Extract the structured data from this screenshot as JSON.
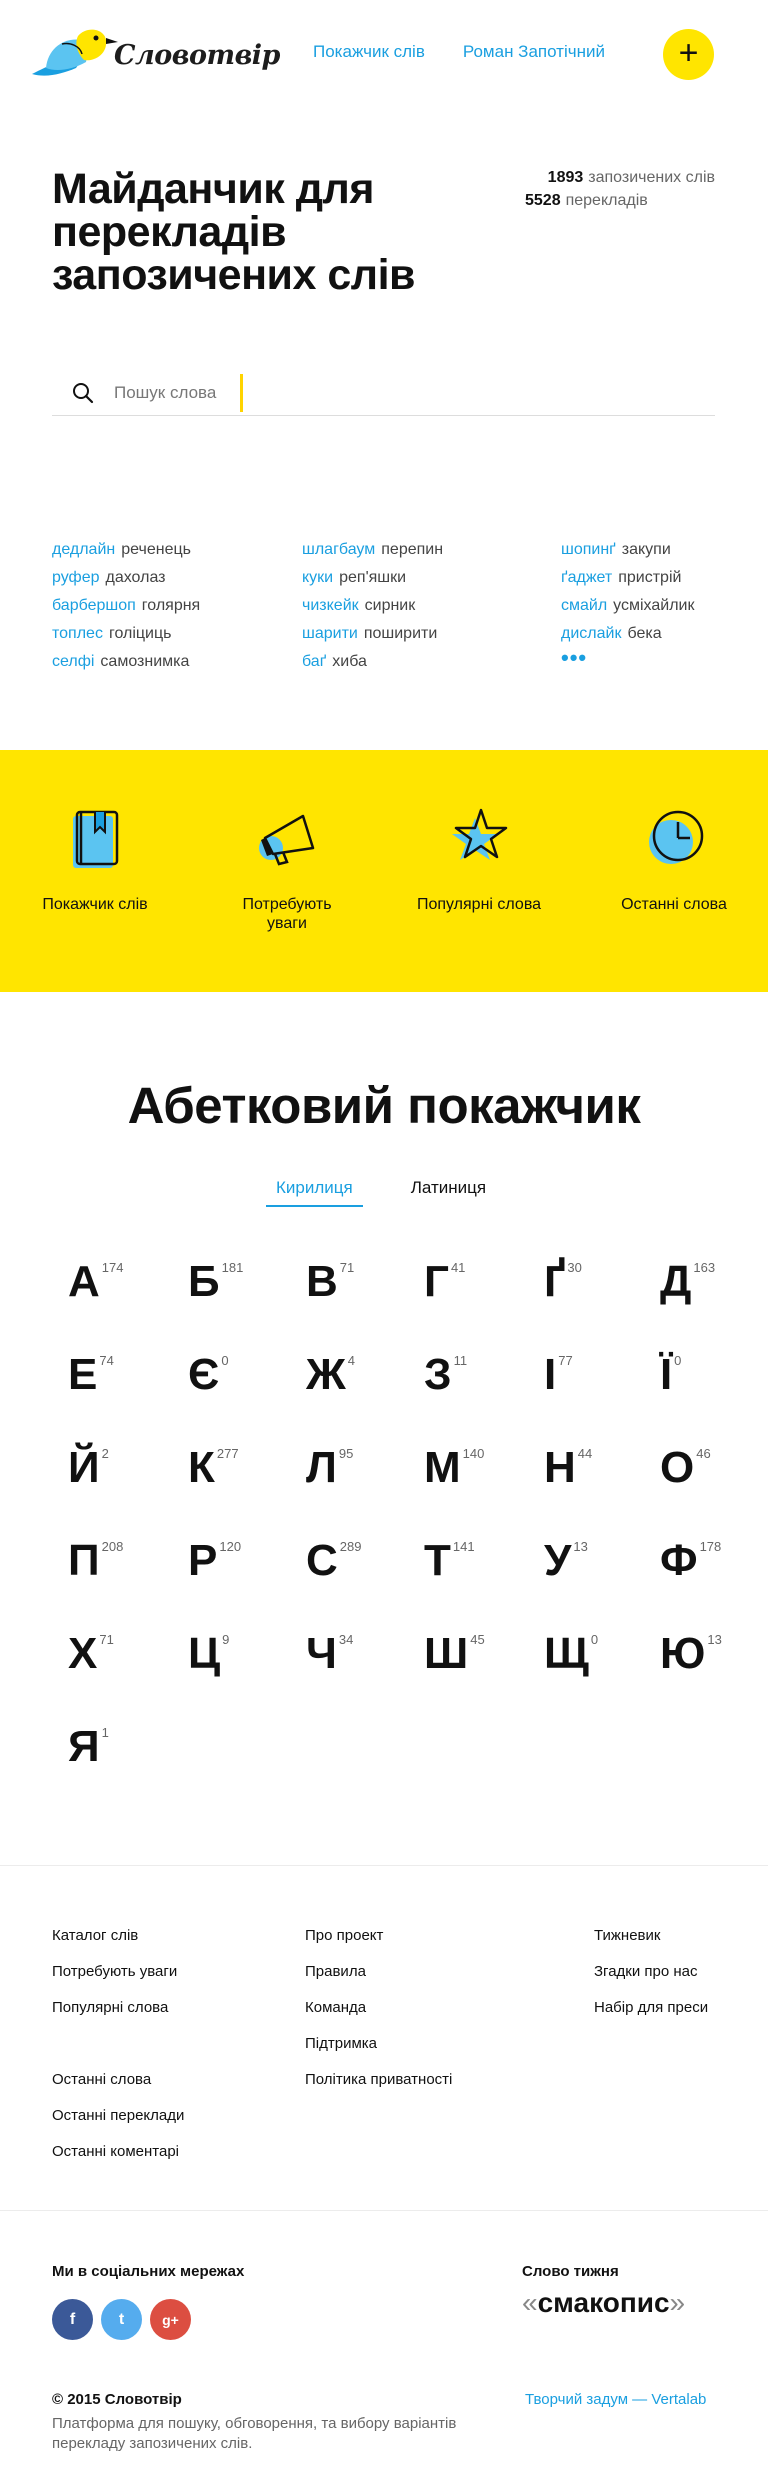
{
  "header": {
    "logo_text": "Словотвір",
    "nav": [
      "Покажчик слів",
      "Роман Запотічний"
    ],
    "add_label": "+"
  },
  "hero": {
    "title": "Майданчик для перекладів запозичених слів",
    "stats": [
      {
        "count": "1893",
        "label": "запозичених слів"
      },
      {
        "count": "5528",
        "label": "перекладів"
      }
    ],
    "search_placeholder": "Пошук слова"
  },
  "pairs": {
    "col1": [
      {
        "src": "дедлайн",
        "tr": "реченець"
      },
      {
        "src": "руфер",
        "tr": "дахолаз"
      },
      {
        "src": "барбершоп",
        "tr": "голярня"
      },
      {
        "src": "топлес",
        "tr": "голіциць"
      },
      {
        "src": "селфі",
        "tr": "самознимка"
      }
    ],
    "col2": [
      {
        "src": "шлагбаум",
        "tr": "перепин"
      },
      {
        "src": "куки",
        "tr": "реп'яшки"
      },
      {
        "src": "чизкейк",
        "tr": "сирник"
      },
      {
        "src": "шарити",
        "tr": "поширити"
      },
      {
        "src": "баґ",
        "tr": "хиба"
      }
    ],
    "col3": [
      {
        "src": "шопинґ",
        "tr": "закупи"
      },
      {
        "src": "ґаджет",
        "tr": "пристрій"
      },
      {
        "src": "смайл",
        "tr": "усміхайлик"
      },
      {
        "src": "дислайк",
        "tr": "бека"
      }
    ],
    "more": "•••"
  },
  "band": {
    "items": [
      {
        "label": "Покажчик слів",
        "icon": "book-icon"
      },
      {
        "label": "Потребують уваги",
        "icon": "megaphone-icon"
      },
      {
        "label": "Популярні слова",
        "icon": "star-icon"
      },
      {
        "label": "Останні слова",
        "icon": "clock-icon"
      }
    ]
  },
  "alphabet": {
    "title": "Абетковий покажчик",
    "tabs": [
      "Кирилиця",
      "Латиниця"
    ],
    "letters": [
      {
        "ch": "А",
        "n": "174"
      },
      {
        "ch": "Б",
        "n": "181"
      },
      {
        "ch": "В",
        "n": "71"
      },
      {
        "ch": "Г",
        "n": "41"
      },
      {
        "ch": "Ґ",
        "n": "30"
      },
      {
        "ch": "Д",
        "n": "163"
      },
      {
        "ch": "Е",
        "n": "74"
      },
      {
        "ch": "Є",
        "n": "0"
      },
      {
        "ch": "Ж",
        "n": "4"
      },
      {
        "ch": "З",
        "n": "11"
      },
      {
        "ch": "І",
        "n": "77"
      },
      {
        "ch": "Ї",
        "n": "0"
      },
      {
        "ch": "Й",
        "n": "2"
      },
      {
        "ch": "К",
        "n": "277"
      },
      {
        "ch": "Л",
        "n": "95"
      },
      {
        "ch": "М",
        "n": "140"
      },
      {
        "ch": "Н",
        "n": "44"
      },
      {
        "ch": "О",
        "n": "46"
      },
      {
        "ch": "П",
        "n": "208"
      },
      {
        "ch": "Р",
        "n": "120"
      },
      {
        "ch": "С",
        "n": "289"
      },
      {
        "ch": "Т",
        "n": "141"
      },
      {
        "ch": "У",
        "n": "13"
      },
      {
        "ch": "Ф",
        "n": "178"
      },
      {
        "ch": "Х",
        "n": "71"
      },
      {
        "ch": "Ц",
        "n": "9"
      },
      {
        "ch": "Ч",
        "n": "34"
      },
      {
        "ch": "Ш",
        "n": "45"
      },
      {
        "ch": "Щ",
        "n": "0"
      },
      {
        "ch": "Ю",
        "n": "13"
      },
      {
        "ch": "Я",
        "n": "1"
      }
    ]
  },
  "footer": {
    "col1": [
      "Каталог слів",
      "Потребують уваги",
      "Популярні слова"
    ],
    "col1b": [
      "Останні слова",
      "Останні переклади",
      "Останні коментарі"
    ],
    "col2": [
      "Про проект",
      "Правила",
      "Команда",
      "Підтримка",
      "Політика приватності"
    ],
    "col3": [
      "Тижневик",
      "Згадки про нас",
      "Набір для преси"
    ],
    "social_title": "Ми в соціальних мережах",
    "socials": [
      {
        "label": "f",
        "icon": "facebook-icon"
      },
      {
        "label": "t",
        "icon": "twitter-icon"
      },
      {
        "label": "g+",
        "icon": "google-plus-icon"
      }
    ],
    "word_of_week_title": "Слово тижня",
    "word_of_week": "смакопис",
    "quote_open": "«",
    "quote_close": "»",
    "copyright": "© 2015 Словотвір",
    "description": "Платформа для пошуку, обговорення, та вибору варіантів перекладу запозичених слів.",
    "credit": "Творчий задум — Vertalab"
  },
  "colors": {
    "accent_blue": "#1a9fe0",
    "accent_yellow": "#ffe500",
    "light_blue": "#5bc4f1"
  }
}
